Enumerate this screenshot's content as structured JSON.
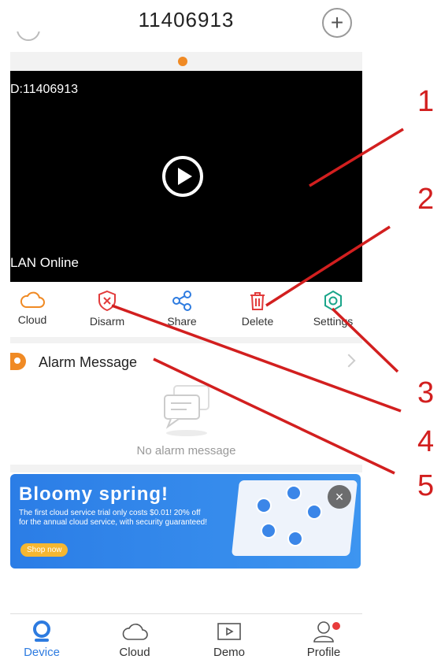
{
  "header": {
    "title": "11406913"
  },
  "video": {
    "cam_id": "D:11406913",
    "status": "LAN Online"
  },
  "actions": [
    {
      "label": "Cloud",
      "icon": "cloud-icon",
      "color": "#f08a24"
    },
    {
      "label": "Disarm",
      "icon": "shield-x-icon",
      "color": "#e23b3b"
    },
    {
      "label": "Share",
      "icon": "share-icon",
      "color": "#2d7be0"
    },
    {
      "label": "Delete",
      "icon": "trash-icon",
      "color": "#e23b3b"
    },
    {
      "label": "Settings",
      "icon": "gear-icon",
      "color": "#1aa58a"
    }
  ],
  "alarm": {
    "title": "Alarm Message",
    "empty_text": "No alarm message"
  },
  "banner": {
    "headline": "Bloomy spring!",
    "sub": "The first cloud service trial only costs $0.01! 20% off for the annual cloud service, with security guaranteed!",
    "cta": "Shop now",
    "close": "×"
  },
  "tabs": [
    {
      "label": "Device",
      "icon": "device-icon",
      "active": true
    },
    {
      "label": "Cloud",
      "icon": "cloud-icon"
    },
    {
      "label": "Demo",
      "icon": "play-box-icon"
    },
    {
      "label": "Profile",
      "icon": "profile-icon",
      "badge": true
    }
  ],
  "annotations": [
    "1",
    "2",
    "3",
    "4",
    "5"
  ],
  "colors": {
    "accent": "#2d7be0",
    "orange": "#f08a24",
    "annotation": "#d21f1f"
  }
}
